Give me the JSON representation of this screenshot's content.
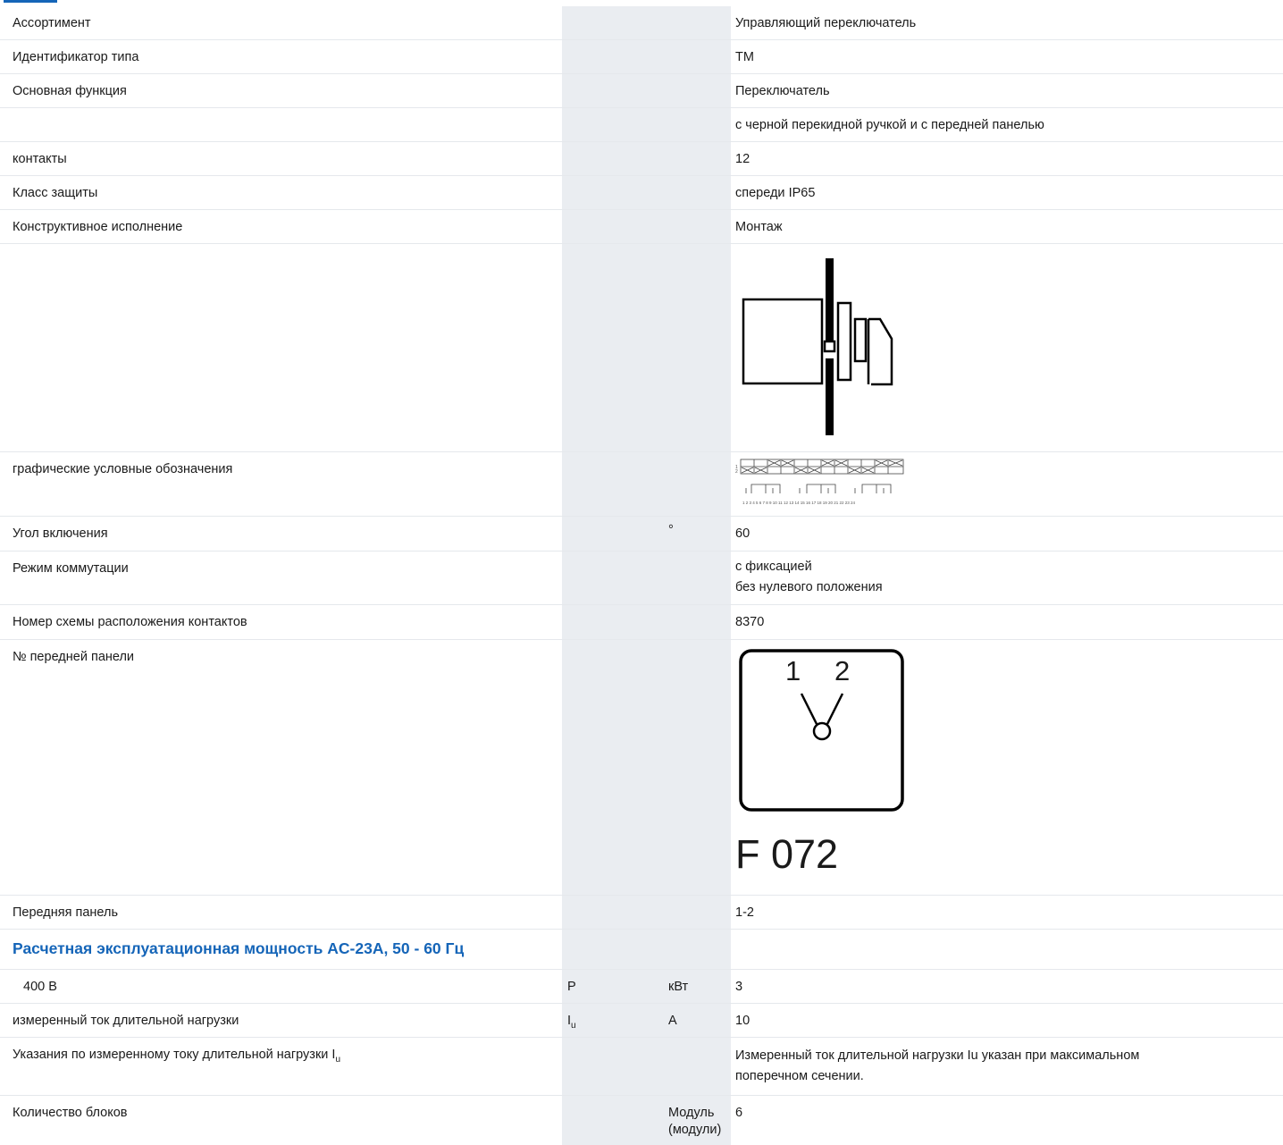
{
  "rows": [
    {
      "label": "Ассортимент",
      "value": "Управляющий переключатель"
    },
    {
      "label": "Идентификатор типа",
      "value": "TM"
    },
    {
      "label": "Основная функция",
      "value": "Переключатель"
    },
    {
      "label": "",
      "value": "с черной перекидной ручкой и с передней панелью"
    },
    {
      "label": "контакты",
      "value": "12"
    },
    {
      "label": "Класс защиты",
      "value": "спереди IP65"
    },
    {
      "label": "Конструктивное исполнение",
      "value": "Монтаж"
    },
    {
      "label": "графические условные обозначения"
    },
    {
      "label": "Угол включения",
      "unit": "°",
      "value": "60"
    },
    {
      "label": "Режим коммутации",
      "value": "с фиксацией\nбез нулевого положения"
    },
    {
      "label": "Номер схемы расположения контактов",
      "value": "8370"
    },
    {
      "label": "№ передней панели",
      "panel_labels": [
        "1",
        "2"
      ],
      "panel_code": "F 072"
    },
    {
      "label": "Передняя панель",
      "value": "1-2"
    }
  ],
  "section_title": "Расчетная эксплуатационная мощность AC-23A, 50 - 60 Гц",
  "power_rows": [
    {
      "label": "400 В",
      "symbol": "P",
      "unit": "кВт",
      "value": "3"
    },
    {
      "label": "измеренный ток длительной нагрузки",
      "symbol": "I",
      "symbol_sub": "u",
      "unit": "A",
      "value": "10"
    },
    {
      "label": "Указания по измеренному току длительной нагрузки I",
      "label_sub": "u",
      "value": "Измеренный ток длительной нагрузки Iu указан при максимальном\nпоперечном сечении."
    },
    {
      "label": "Количество блоков",
      "unit": "Модуль\n(модули)",
      "value": "6"
    }
  ],
  "colors": {
    "accent": "#1565b8",
    "shaded_column": "#eaedf1",
    "divider": "#e5e8ec"
  },
  "icons": {
    "mounting": "switch-mounting-diagram-icon",
    "symbol": "contact-diagram-icon",
    "front_plate": "front-plate-icon"
  }
}
